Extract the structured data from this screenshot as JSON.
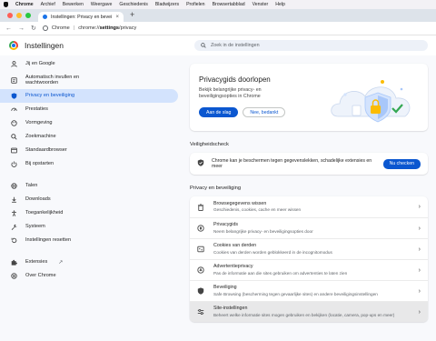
{
  "menubar": {
    "items": [
      "Chrome",
      "Archief",
      "Bewerken",
      "Weergave",
      "Geschiedenis",
      "Bladwijzers",
      "Profielen",
      "Browsertabblad",
      "Venster",
      "Help"
    ]
  },
  "browser": {
    "tab_title": "Instellingen: Privacy en beveili",
    "tab_close": "×",
    "new_tab": "+",
    "site_name": "Chrome",
    "url_prefix": "chrome://",
    "url_bold": "settings",
    "url_suffix": "/privacy",
    "accent": "#0b57d0"
  },
  "header": {
    "title": "Instellingen",
    "search_placeholder": "Zoek in de instellingen"
  },
  "sidebar": {
    "items": [
      {
        "label": "Jij en Google",
        "icon": "person-icon"
      },
      {
        "label": "Automatisch invullen en wachtwoorden",
        "icon": "autofill-icon"
      },
      {
        "label": "Privacy en beveiliging",
        "icon": "shield-icon"
      },
      {
        "label": "Prestaties",
        "icon": "speedometer-icon"
      },
      {
        "label": "Vormgeving",
        "icon": "palette-icon"
      },
      {
        "label": "Zoekmachine",
        "icon": "search-icon"
      },
      {
        "label": "Standaardbrowser",
        "icon": "browser-icon"
      },
      {
        "label": "Bij opstarten",
        "icon": "power-icon"
      },
      {
        "label": "Talen",
        "icon": "globe-icon"
      },
      {
        "label": "Downloads",
        "icon": "download-icon"
      },
      {
        "label": "Toegankelijkheid",
        "icon": "accessibility-icon"
      },
      {
        "label": "Systeem",
        "icon": "wrench-icon"
      },
      {
        "label": "Instellingen resetten",
        "icon": "reset-icon"
      },
      {
        "label": "Extensies",
        "icon": "puzzle-icon"
      },
      {
        "label": "Over Chrome",
        "icon": "chrome-icon"
      }
    ]
  },
  "privacy_guide": {
    "title": "Privacygids doorlopen",
    "description": "Bekijk belangrijke privacy- en beveiligingsopties in Chrome",
    "primary_button": "Aan de slag",
    "secondary_button": "Nee, bedankt"
  },
  "safety_check": {
    "heading": "Veiligheidscheck",
    "text": "Chrome kan je beschermen tegen gegevenslekken, schadelijke extensies en meer",
    "button": "Nu checken"
  },
  "privacy_section": {
    "heading": "Privacy en beveiliging",
    "rows": [
      {
        "title": "Browsegegevens wissen",
        "subtitle": "Geschiedenis, cookies, cache en meer wissen",
        "icon": "trash-icon"
      },
      {
        "title": "Privacygids",
        "subtitle": "Neem belangrijke privacy- en beveiligingsopties door",
        "icon": "privacy-guide-icon"
      },
      {
        "title": "Cookies van derden",
        "subtitle": "Cookies van derden worden geblokkeerd in de incognitomodus",
        "icon": "cookie-icon"
      },
      {
        "title": "Advertentieprivacy",
        "subtitle": "Pas de informatie aan die sites gebruiken om advertenties te laten zien",
        "icon": "ad-privacy-icon"
      },
      {
        "title": "Beveiliging",
        "subtitle": "Safe Browsing (bescherming tegen gevaarlijke sites) en andere beveiligingsinstellingen",
        "icon": "shield-icon"
      },
      {
        "title": "Site-instellingen",
        "subtitle": "Beheert welke informatie sites mogen gebruiken en bekijken (locatie, camera, pop-ups en meer)",
        "icon": "sliders-icon"
      }
    ]
  }
}
